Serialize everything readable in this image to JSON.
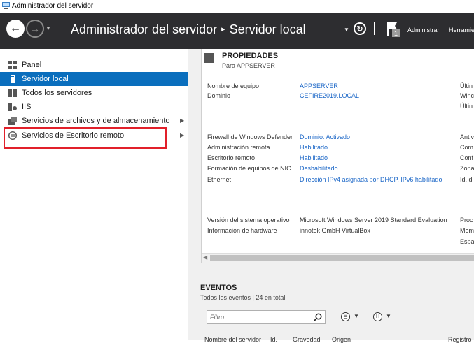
{
  "window": {
    "title": "Administrador del servidor"
  },
  "header": {
    "breadcrumb_root": "Administrador del servidor",
    "breadcrumb_separator": "▸",
    "breadcrumb_current": "Servidor local",
    "notification_count": "1",
    "menu_manage": "Administrar",
    "menu_tools": "Herramie"
  },
  "sidebar": {
    "items": [
      {
        "label": "Panel",
        "icon": "dashboard-icon",
        "active": false
      },
      {
        "label": "Servidor local",
        "icon": "server-icon",
        "active": true
      },
      {
        "label": "Todos los servidores",
        "icon": "servers-icon",
        "active": false
      },
      {
        "label": "IIS",
        "icon": "iis-icon",
        "active": false
      },
      {
        "label": "Servicios de archivos y de almacenamiento",
        "icon": "file-storage-icon",
        "active": false,
        "expandable": true
      },
      {
        "label": "Servicios de Escritorio remoto",
        "icon": "remote-desktop-icon",
        "active": false,
        "expandable": true,
        "highlighted": true
      }
    ]
  },
  "properties": {
    "title": "PROPIEDADES",
    "subtitle": "Para APPSERVER",
    "rows": [
      {
        "label": "Nombre de equipo",
        "value": "APPSERVER",
        "link": true
      },
      {
        "label": "Dominio",
        "value": "CEFIRE2019.LOCAL",
        "link": true
      },
      {
        "label": "Firewall de Windows Defender",
        "value": "Dominio: Activado",
        "link": true
      },
      {
        "label": "Administración remota",
        "value": "Habilitado",
        "link": true
      },
      {
        "label": "Escritorio remoto",
        "value": "Habilitado",
        "link": true
      },
      {
        "label": "Formación de equipos de NIC",
        "value": "Deshabilitado",
        "link": true
      },
      {
        "label": "Ethernet",
        "value": "Dirección IPv4 asignada por DHCP, IPv6 habilitado",
        "link": true
      },
      {
        "label": "Versión del sistema operativo",
        "value": "Microsoft Windows Server 2019 Standard Evaluation",
        "link": false
      },
      {
        "label": "Información de hardware",
        "value": "innotek GmbH VirtualBox",
        "link": false
      }
    ],
    "right_column": [
      "Últin",
      "Winc",
      "Últin",
      "Antiv",
      "Com",
      "Conf",
      "Zona",
      "Id. d",
      "Proc",
      "Mem",
      "Espa"
    ]
  },
  "events": {
    "title": "EVENTOS",
    "subtitle": "Todos los eventos | 24 en total",
    "filter_placeholder": "Filtro",
    "columns": [
      "Nombre del servidor",
      "Id.",
      "Gravedad",
      "Origen",
      "Registro"
    ]
  },
  "colors": {
    "accent": "#0a6ebd",
    "header_bg": "#2d2d30",
    "link": "#1a66c7",
    "highlight_box": "#e1202a"
  }
}
